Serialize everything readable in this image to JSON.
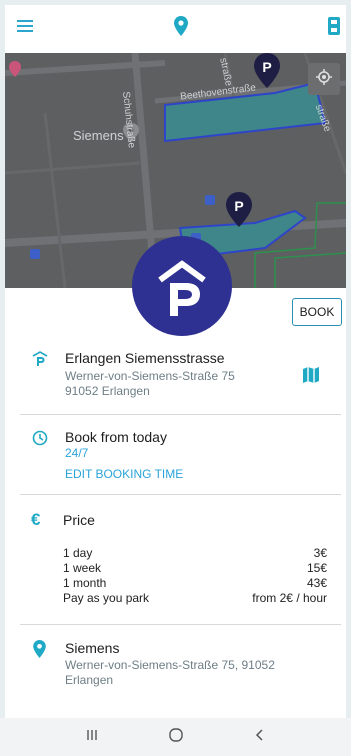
{
  "header": {
    "menu_icon": "menu-icon",
    "location_icon": "location-pin-icon",
    "parking_icon": "parking-lot-icon"
  },
  "map": {
    "streets": [
      "Beethovenstraße",
      "Schuhstraße",
      "straße",
      "straße"
    ],
    "poi": "Siemens",
    "locate_icon": "crosshair-icon"
  },
  "detail": {
    "book_label": "BOOK",
    "place": {
      "name": "Erlangen Siemensstrasse",
      "street": "Werner-von-Siemens-Straße 75",
      "city": "91052 Erlangen"
    },
    "booking": {
      "title": "Book from today",
      "hours": "24/7",
      "edit_label": "EDIT BOOKING TIME"
    },
    "price": {
      "title": "Price",
      "rows": [
        {
          "label": "1 day",
          "value": "3€"
        },
        {
          "label": "1 week",
          "value": "15€"
        },
        {
          "label": "1 month",
          "value": "43€"
        },
        {
          "label": "Pay as you park",
          "value": "from 2€ / hour"
        }
      ]
    },
    "company": {
      "name": "Siemens",
      "address_line1": "Werner-von-Siemens-Straße 75, 91052",
      "address_line2": "Erlangen"
    }
  },
  "colors": {
    "accent": "#1fa9c5",
    "parking_blue": "#2e3192",
    "map_bg": "#5d5f61"
  }
}
